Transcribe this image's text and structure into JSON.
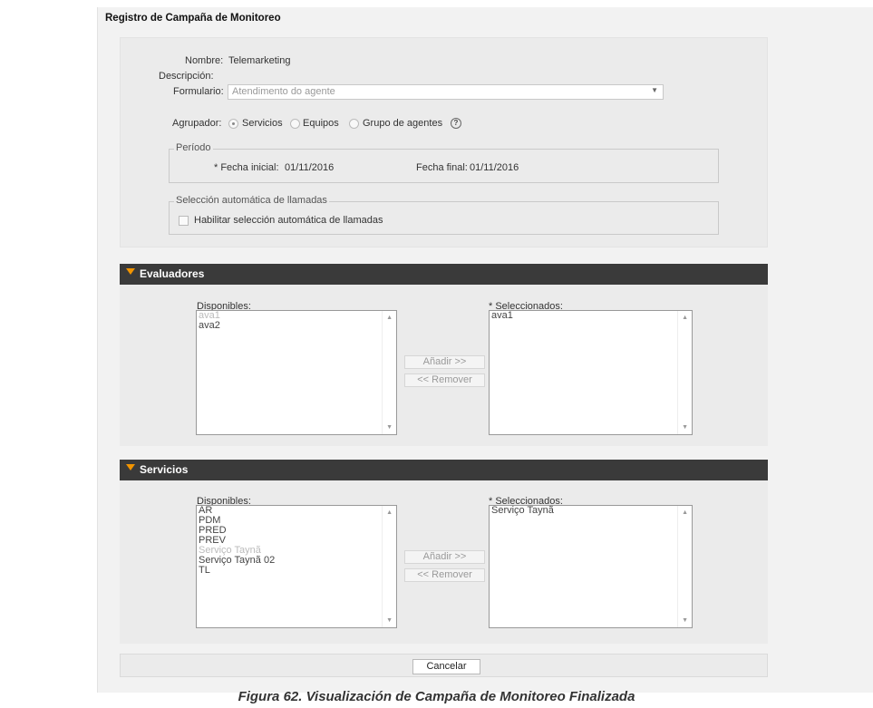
{
  "page_title": "Registro de Campaña de Monitoreo",
  "form": {
    "nombre_label": "Nombre:",
    "nombre_value": "Telemarketing",
    "descripcion_label": "Descripción:",
    "formulario_label": "Formulario:",
    "formulario_value": "Atendimento do agente",
    "agrupador_label": "Agrupador:",
    "agrupador_options": [
      "Servicios",
      "Equipos",
      "Grupo de agentes"
    ],
    "agrupador_selected": "Servicios",
    "help_glyph": "?"
  },
  "periodo": {
    "legend": "Período",
    "fecha_inicial_label": "* Fecha inicial:",
    "fecha_inicial_value": "01/11/2016",
    "fecha_final_label": "Fecha final:",
    "fecha_final_value": "01/11/2016"
  },
  "seleccion": {
    "legend": "Selección automática de llamadas",
    "checkbox_label": "Habilitar selección automática de llamadas",
    "checked": false
  },
  "evaluadores": {
    "title": "Evaluadores",
    "disponibles_label": "Disponibles:",
    "disponibles_items": [
      {
        "label": "ava1",
        "dim": true
      },
      {
        "label": "ava2",
        "dim": false
      }
    ],
    "seleccionados_label": "* Seleccionados:",
    "seleccionados_items": [
      {
        "label": "ava1",
        "dim": false
      }
    ],
    "add_label": "Añadir >>",
    "remove_label": "<< Remover"
  },
  "servicios": {
    "title": "Servicios",
    "disponibles_label": "Disponibles:",
    "disponibles_items": [
      {
        "label": "AR",
        "dim": false
      },
      {
        "label": "PDM",
        "dim": false
      },
      {
        "label": "PRED",
        "dim": false
      },
      {
        "label": "PREV",
        "dim": false
      },
      {
        "label": "Serviço Taynã",
        "dim": true
      },
      {
        "label": "Serviço Taynã 02",
        "dim": false
      },
      {
        "label": "TL",
        "dim": false
      }
    ],
    "seleccionados_label": "* Seleccionados:",
    "seleccionados_items": [
      {
        "label": "Serviço Taynã",
        "dim": false
      }
    ],
    "add_label": "Añadir >>",
    "remove_label": "<< Remover"
  },
  "footer": {
    "cancel_label": "Cancelar"
  },
  "caption": "Figura 62. Visualización de Campaña de Monitoreo Finalizada"
}
